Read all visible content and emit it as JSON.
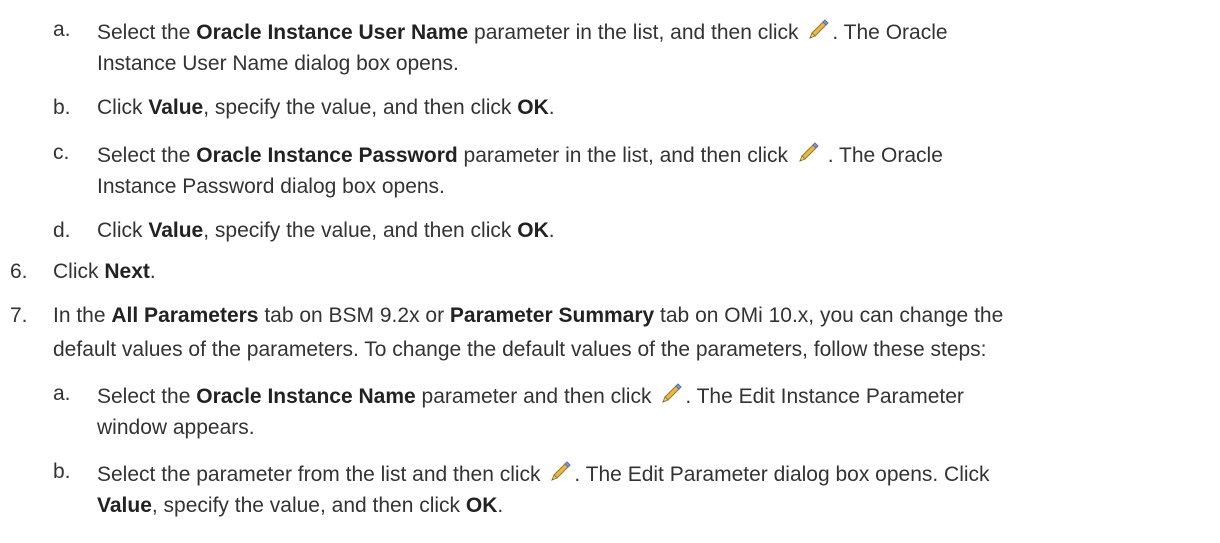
{
  "steps": {
    "a1": {
      "marker": "a.",
      "p1": "Select the ",
      "b1": "Oracle Instance User Name",
      "p2": " parameter in the list, and then click ",
      "p3": ". The Oracle",
      "cont": "Instance User Name dialog box opens."
    },
    "b1": {
      "marker": "b.",
      "p1": "Click ",
      "b1": "Value",
      "p2": ", specify the value, and then click ",
      "b2": "OK",
      "p3": "."
    },
    "c1": {
      "marker": "c.",
      "p1": "Select the ",
      "b1": "Oracle Instance Password",
      "p2": " parameter in the list, and then click ",
      "p3": " . The Oracle",
      "cont": "Instance Password dialog box opens."
    },
    "d1": {
      "marker": "d.",
      "p1": "Click ",
      "b1": "Value",
      "p2": ", specify the value, and then click ",
      "b2": "OK",
      "p3": "."
    },
    "s6": {
      "marker": "6.",
      "p1": "Click ",
      "b1": "Next",
      "p2": "."
    },
    "s7": {
      "marker": "7.",
      "p1": "In the ",
      "b1": "All Parameters",
      "p2": " tab on BSM 9.2x or ",
      "b2": "Parameter Summary",
      "p3": " tab on OMi 10.x, you can change the",
      "cont": "default values of the parameters. To change the default values of the parameters, follow these steps:"
    },
    "a2": {
      "marker": "a.",
      "p1": "Select the ",
      "b1": "Oracle Instance Name",
      "p2": " parameter and then click ",
      "p3": ". The Edit Instance Parameter",
      "cont": "window appears."
    },
    "b2": {
      "marker": "b.",
      "p1": "Select the parameter from the list and then click ",
      "p2": ". The Edit Parameter dialog box opens. Click",
      "c_b1": "Value",
      "c_p1": ", specify the value, and then click ",
      "c_b2": "OK",
      "c_p2": "."
    }
  },
  "icons": {
    "edit": "pencil-icon",
    "colors": {
      "pencil_body": "#e8b84a",
      "pencil_edge": "#9a7a2a",
      "pencil_tip": "#f3d9a0",
      "eraser": "#7f9fd6"
    }
  }
}
